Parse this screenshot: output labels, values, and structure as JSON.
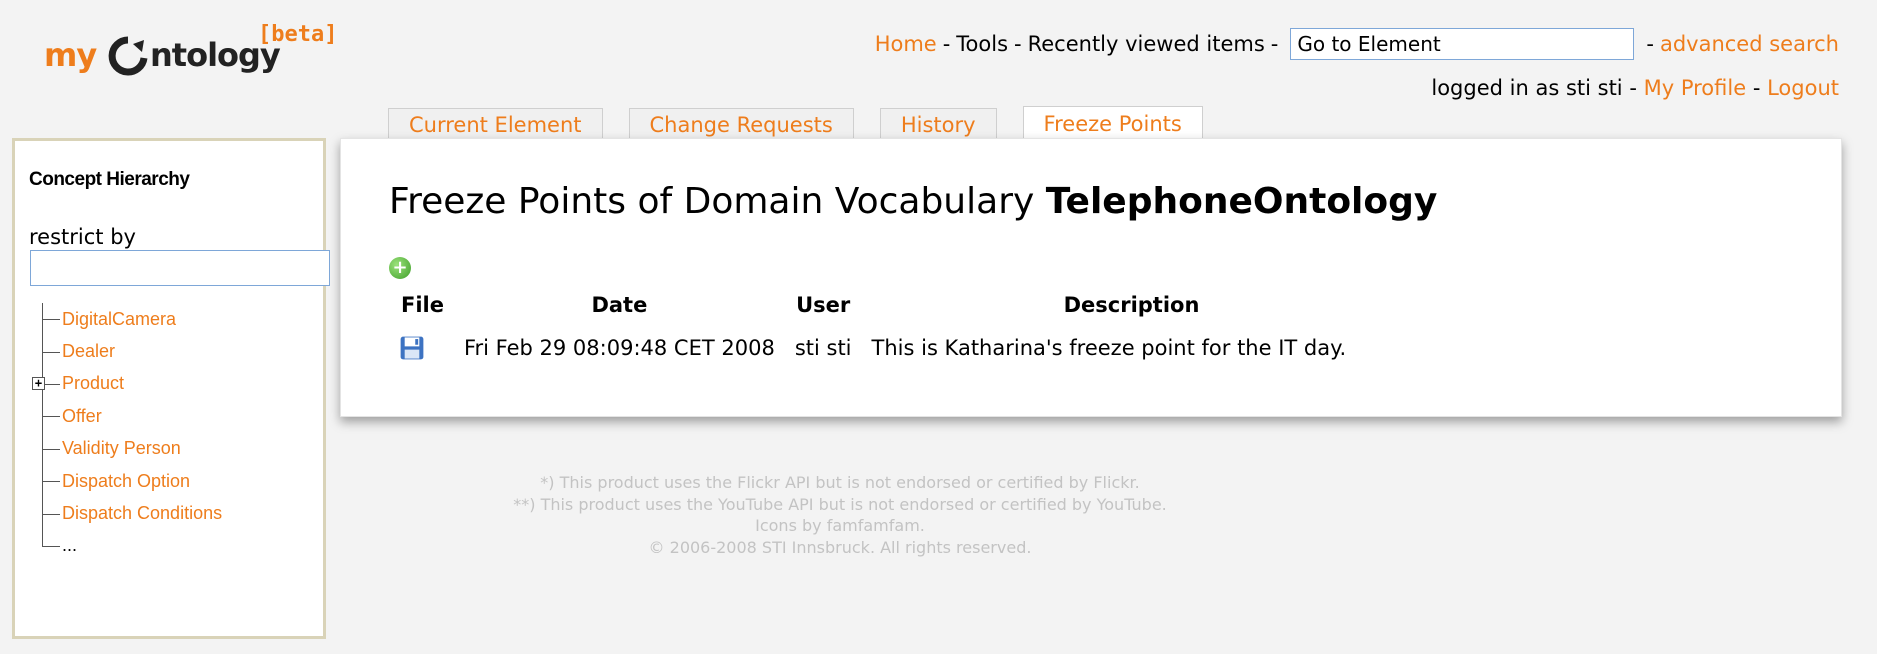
{
  "logo": {
    "part1": "my",
    "part2": "ntology",
    "badge": "[beta]"
  },
  "topnav": {
    "home": "Home",
    "tools": "Tools",
    "recent": "Recently viewed items",
    "goto_value": "Go to Element",
    "advanced_search": "advanced search",
    "sep": "-"
  },
  "user": {
    "logged_in_text": "logged in as sti sti",
    "my_profile": "My Profile",
    "logout": "Logout"
  },
  "tabs": [
    {
      "label": "Current Element"
    },
    {
      "label": "Change Requests"
    },
    {
      "label": "History"
    },
    {
      "label": "Freeze Points",
      "active": true
    }
  ],
  "main": {
    "title_prefix": "Freeze Points of Domain Vocabulary",
    "title_name": "TelephoneOntology",
    "table": {
      "headers": [
        "File",
        "Date",
        "User",
        "Description"
      ],
      "rows": [
        {
          "date": "Fri Feb 29 08:09:48 CET 2008",
          "user": "sti sti",
          "description": "This is Katharina's freeze point for the IT day."
        }
      ]
    }
  },
  "sidebar": {
    "title": "Concept Hierarchy",
    "restrict_label": "restrict by",
    "restrict_value": "",
    "tree": [
      {
        "label": "DigitalCamera"
      },
      {
        "label": "Dealer"
      },
      {
        "label": "Product",
        "expandable": true
      },
      {
        "label": "Offer"
      },
      {
        "label": "Validity Person"
      },
      {
        "label": "Dispatch Option"
      },
      {
        "label": "Dispatch Conditions"
      },
      {
        "label": "..."
      }
    ]
  },
  "footer": {
    "line1": "*) This product uses the Flickr API but is not endorsed or certified by Flickr.",
    "line2": "**) This product uses the YouTube API but is not endorsed or certified by YouTube.",
    "line3": "Icons by famfamfam.",
    "line4": "© 2006-2008 STI Innsbruck. All rights reserved."
  },
  "icons": {
    "add": "add-icon",
    "save": "disk-icon",
    "expand": "plus-box-icon"
  },
  "colors": {
    "accent": "#ee7d1c",
    "background": "#f3f3f3",
    "sidebar_border": "#d9d3b8",
    "input_border": "#7ea7d8",
    "footer_text": "#c3c3c3"
  }
}
